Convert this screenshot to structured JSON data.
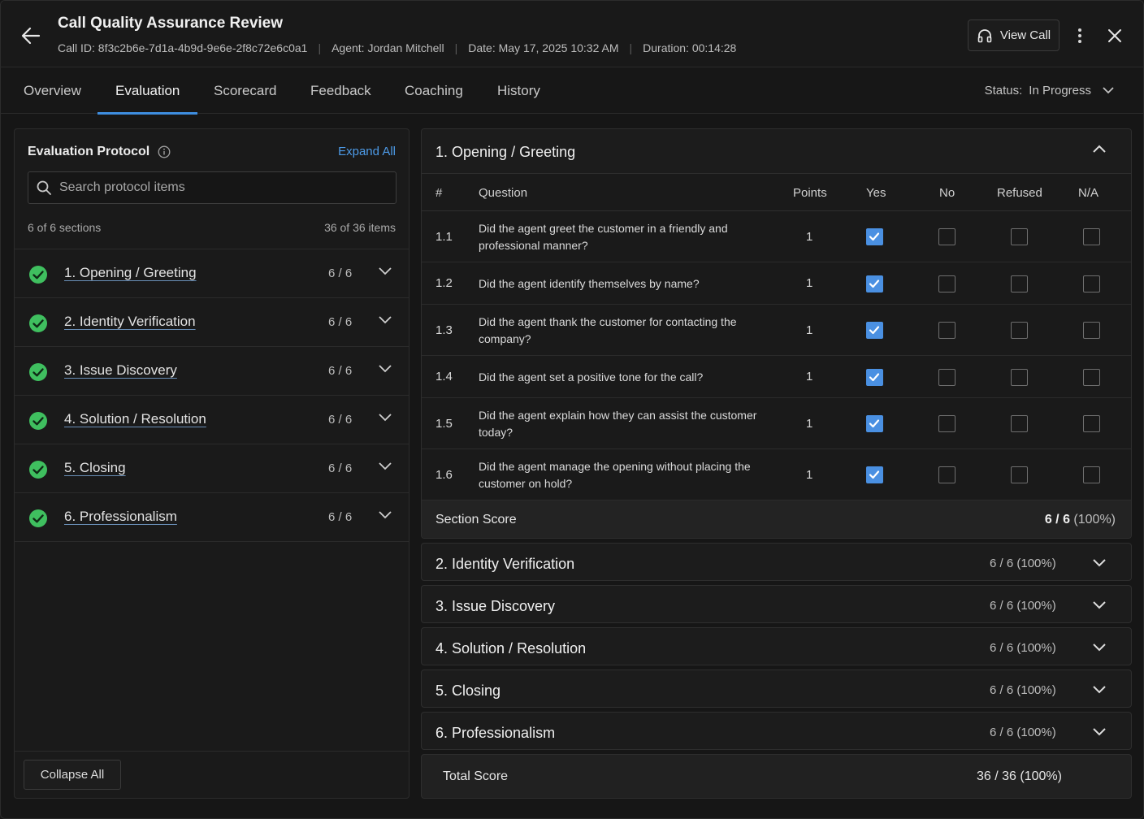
{
  "header": {
    "title": "Call Quality Assurance Review",
    "call_id": "Call ID: 8f3c2b6e-7d1a-4b9d-9e6e-2f8c72e6c0a1",
    "agent": "Agent: Jordan Mitchell",
    "date": "Date: May 17, 2025 10:32 AM",
    "duration": "Duration: 00:14:28",
    "view_call_label": "View Call"
  },
  "tabs": [
    {
      "label": "Overview",
      "active": false
    },
    {
      "label": "Evaluation",
      "active": true
    },
    {
      "label": "Scorecard",
      "active": false
    },
    {
      "label": "Feedback",
      "active": false
    },
    {
      "label": "Coaching",
      "active": false
    },
    {
      "label": "History",
      "active": false
    }
  ],
  "status": {
    "label": "Status:",
    "value": "In Progress"
  },
  "left_panel": {
    "title": "Evaluation Protocol",
    "expand_all": "Expand All",
    "search_placeholder": "Search protocol items",
    "sections_count": "6 of 6 sections",
    "items_count": "36 of 36 items",
    "sections": [
      {
        "name": "1. Opening / Greeting",
        "score": "6 / 6",
        "complete": true
      },
      {
        "name": "2. Identity Verification",
        "score": "6 / 6",
        "complete": true
      },
      {
        "name": "3. Issue Discovery",
        "score": "6 / 6",
        "complete": true
      },
      {
        "name": "4. Solution / Resolution",
        "score": "6 / 6",
        "complete": true
      },
      {
        "name": "5. Closing",
        "score": "6 / 6",
        "complete": true
      },
      {
        "name": "6. Professionalism",
        "score": "6 / 6",
        "complete": true
      }
    ],
    "collapse_all": "Collapse All"
  },
  "open_section": {
    "title": "1. Opening / Greeting",
    "columns": {
      "num": "#",
      "question": "Question",
      "points": "Points",
      "yes": "Yes",
      "no": "No",
      "refused": "Refused",
      "na": "N/A"
    },
    "rows": [
      {
        "num": "1.1",
        "question": "Did the agent greet the customer in a friendly and professional manner?",
        "points": "1",
        "answer": "yes"
      },
      {
        "num": "1.2",
        "question": "Did the agent identify themselves by name?",
        "points": "1",
        "answer": "yes"
      },
      {
        "num": "1.3",
        "question": "Did the agent thank the customer for contacting the company?",
        "points": "1",
        "answer": "yes"
      },
      {
        "num": "1.4",
        "question": "Did the agent set a positive tone for the call?",
        "points": "1",
        "answer": "yes"
      },
      {
        "num": "1.5",
        "question": "Did the agent explain how they can assist the customer today?",
        "points": "1",
        "answer": "yes"
      },
      {
        "num": "1.6",
        "question": "Did the agent manage the opening without placing the customer on hold?",
        "points": "1",
        "answer": "yes"
      }
    ],
    "section_score_label": "Section Score",
    "section_score_value": "6 / 6",
    "section_score_pct": "(100%)"
  },
  "collapsed_sections": [
    {
      "title": "2. Identity Verification",
      "score": "6 / 6 (100%)"
    },
    {
      "title": "3. Issue Discovery",
      "score": "6 / 6 (100%)"
    },
    {
      "title": "4. Solution / Resolution",
      "score": "6 / 6 (100%)"
    },
    {
      "title": "5. Closing",
      "score": "6 / 6 (100%)"
    },
    {
      "title": "6. Professionalism",
      "score": "6 / 6 (100%)"
    }
  ],
  "total": {
    "label": "Total Score",
    "value": "36 / 36 (100%)"
  },
  "colors": {
    "accent": "#4a90e2",
    "success": "#3fbf5f",
    "background": "#161616"
  }
}
